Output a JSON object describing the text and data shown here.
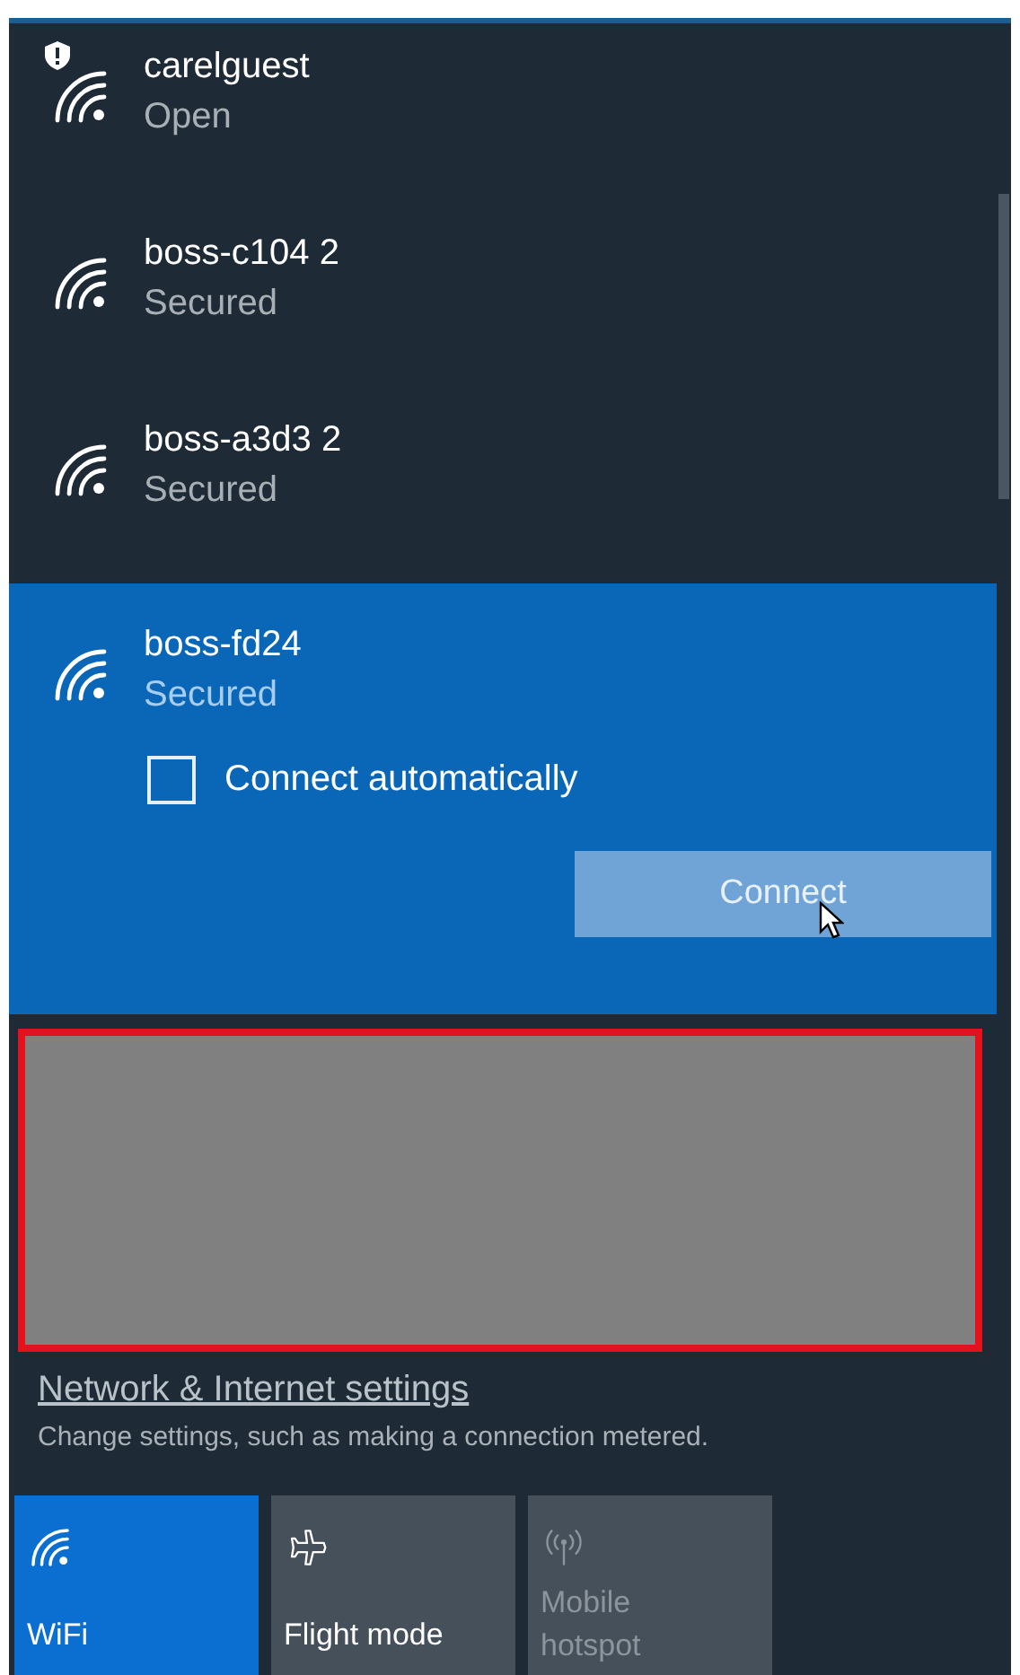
{
  "networks": [
    {
      "name": "carelguest",
      "status": "Open",
      "warning": true,
      "selected": false
    },
    {
      "name": "boss-c104 2",
      "status": "Secured",
      "warning": false,
      "selected": false
    },
    {
      "name": "boss-a3d3 2",
      "status": "Secured",
      "warning": false,
      "selected": false
    },
    {
      "name": "boss-fd24",
      "status": "Secured",
      "warning": false,
      "selected": true,
      "connect_automatically": {
        "label": "Connect automatically",
        "checked": false
      },
      "button": "Connect"
    }
  ],
  "redaction": {
    "kind": "box"
  },
  "settings_link": "Network & Internet settings",
  "settings_hint": "Change settings, such as making a connection metered.",
  "tiles": [
    {
      "kind": "wifi",
      "label": "WiFi",
      "on": true,
      "disabled": false
    },
    {
      "kind": "flight",
      "label": "Flight mode",
      "on": false,
      "disabled": false
    },
    {
      "kind": "hotspot",
      "label": "Mobile hotspot",
      "on": false,
      "disabled": true
    }
  ]
}
